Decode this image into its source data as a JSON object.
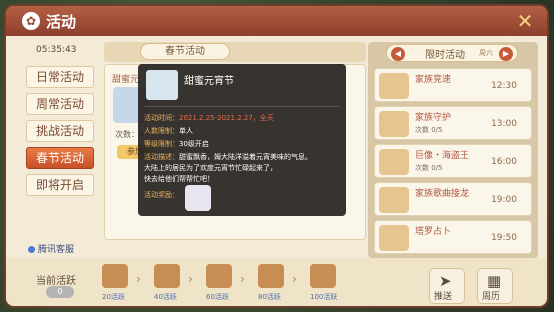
{
  "window": {
    "title": "活动"
  },
  "timer": "05:35:43",
  "season": {
    "label": "春节活动"
  },
  "sidebar": {
    "items": [
      {
        "label": "日常活动"
      },
      {
        "label": "周常活动"
      },
      {
        "label": "挑战活动"
      },
      {
        "label": "春节活动",
        "active": true
      },
      {
        "label": "即将开启"
      }
    ]
  },
  "event_card": {
    "title": "甜蜜元",
    "count_label": "次数：4",
    "join_label": "参加"
  },
  "tooltip": {
    "title": "甜蜜元宵节",
    "time_label": "活动时间：",
    "time_value": "2021.2.25-2021.2.27，全天",
    "people_label": "人数限制：",
    "people_value": "单人",
    "level_label": "等级限制：",
    "level_value": "30级开启",
    "desc_label": "活动描述：",
    "desc_line1": "甜蜜飘香，姆大陆洋溢着元宵美味的气息。",
    "desc_line2": "大陆上的居民为了欢度元宵节忙碌起来了，",
    "desc_line3": "快去给他们帮帮忙吧！",
    "reward_label": "活动奖励："
  },
  "tencent_service": "腾讯客服",
  "timed": {
    "title": "限时活动",
    "week": "周六",
    "items": [
      {
        "name": "家族竞速",
        "count": "",
        "time": "12:30"
      },
      {
        "name": "家族守护",
        "count": "次数  0/5",
        "time": "13:00"
      },
      {
        "name": "巨像・海盗王",
        "count": "次数  0/5",
        "time": "16:00"
      },
      {
        "name": "家族歌曲接龙",
        "count": "",
        "time": "19:00"
      },
      {
        "name": "塔罗占卜",
        "count": "",
        "time": "19:50"
      }
    ]
  },
  "activity": {
    "label": "当前活跃",
    "value": "0",
    "rewards": [
      "20活跃",
      "40活跃",
      "60活跃",
      "80活跃",
      "100活跃"
    ]
  },
  "tools": {
    "push_label": "推送",
    "calendar_label": "周历"
  },
  "colors": {
    "accent": "#c8502a",
    "title_bar": "#a04a34",
    "tooltip_label": "#e9b45c",
    "tooltip_value": "#e96a4c"
  }
}
